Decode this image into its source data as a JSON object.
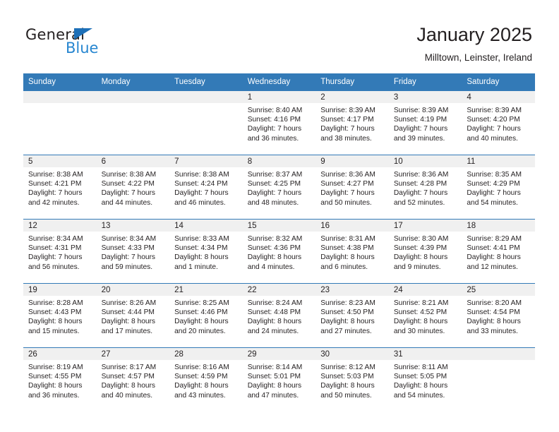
{
  "logo": {
    "word_top": "General",
    "word_bottom": "Blue",
    "triangle_color": "#1d70b8",
    "blue_text_color": "#2786d0"
  },
  "header": {
    "title": "January 2025",
    "subtitle": "Milltown, Leinster, Ireland",
    "accent_color": "#337ab7",
    "daynum_bg": "#f0f0f0"
  },
  "calendar": {
    "weekday_headers": [
      "Sunday",
      "Monday",
      "Tuesday",
      "Wednesday",
      "Thursday",
      "Friday",
      "Saturday"
    ],
    "weeks": [
      [
        {
          "day": "",
          "blank": true
        },
        {
          "day": "",
          "blank": true
        },
        {
          "day": "",
          "blank": true
        },
        {
          "day": "1",
          "sunrise": "Sunrise: 8:40 AM",
          "sunset": "Sunset: 4:16 PM",
          "daylight1": "Daylight: 7 hours",
          "daylight2": "and 36 minutes."
        },
        {
          "day": "2",
          "sunrise": "Sunrise: 8:39 AM",
          "sunset": "Sunset: 4:17 PM",
          "daylight1": "Daylight: 7 hours",
          "daylight2": "and 38 minutes."
        },
        {
          "day": "3",
          "sunrise": "Sunrise: 8:39 AM",
          "sunset": "Sunset: 4:19 PM",
          "daylight1": "Daylight: 7 hours",
          "daylight2": "and 39 minutes."
        },
        {
          "day": "4",
          "sunrise": "Sunrise: 8:39 AM",
          "sunset": "Sunset: 4:20 PM",
          "daylight1": "Daylight: 7 hours",
          "daylight2": "and 40 minutes."
        }
      ],
      [
        {
          "day": "5",
          "sunrise": "Sunrise: 8:38 AM",
          "sunset": "Sunset: 4:21 PM",
          "daylight1": "Daylight: 7 hours",
          "daylight2": "and 42 minutes."
        },
        {
          "day": "6",
          "sunrise": "Sunrise: 8:38 AM",
          "sunset": "Sunset: 4:22 PM",
          "daylight1": "Daylight: 7 hours",
          "daylight2": "and 44 minutes."
        },
        {
          "day": "7",
          "sunrise": "Sunrise: 8:38 AM",
          "sunset": "Sunset: 4:24 PM",
          "daylight1": "Daylight: 7 hours",
          "daylight2": "and 46 minutes."
        },
        {
          "day": "8",
          "sunrise": "Sunrise: 8:37 AM",
          "sunset": "Sunset: 4:25 PM",
          "daylight1": "Daylight: 7 hours",
          "daylight2": "and 48 minutes."
        },
        {
          "day": "9",
          "sunrise": "Sunrise: 8:36 AM",
          "sunset": "Sunset: 4:27 PM",
          "daylight1": "Daylight: 7 hours",
          "daylight2": "and 50 minutes."
        },
        {
          "day": "10",
          "sunrise": "Sunrise: 8:36 AM",
          "sunset": "Sunset: 4:28 PM",
          "daylight1": "Daylight: 7 hours",
          "daylight2": "and 52 minutes."
        },
        {
          "day": "11",
          "sunrise": "Sunrise: 8:35 AM",
          "sunset": "Sunset: 4:29 PM",
          "daylight1": "Daylight: 7 hours",
          "daylight2": "and 54 minutes."
        }
      ],
      [
        {
          "day": "12",
          "sunrise": "Sunrise: 8:34 AM",
          "sunset": "Sunset: 4:31 PM",
          "daylight1": "Daylight: 7 hours",
          "daylight2": "and 56 minutes."
        },
        {
          "day": "13",
          "sunrise": "Sunrise: 8:34 AM",
          "sunset": "Sunset: 4:33 PM",
          "daylight1": "Daylight: 7 hours",
          "daylight2": "and 59 minutes."
        },
        {
          "day": "14",
          "sunrise": "Sunrise: 8:33 AM",
          "sunset": "Sunset: 4:34 PM",
          "daylight1": "Daylight: 8 hours",
          "daylight2": "and 1 minute."
        },
        {
          "day": "15",
          "sunrise": "Sunrise: 8:32 AM",
          "sunset": "Sunset: 4:36 PM",
          "daylight1": "Daylight: 8 hours",
          "daylight2": "and 4 minutes."
        },
        {
          "day": "16",
          "sunrise": "Sunrise: 8:31 AM",
          "sunset": "Sunset: 4:38 PM",
          "daylight1": "Daylight: 8 hours",
          "daylight2": "and 6 minutes."
        },
        {
          "day": "17",
          "sunrise": "Sunrise: 8:30 AM",
          "sunset": "Sunset: 4:39 PM",
          "daylight1": "Daylight: 8 hours",
          "daylight2": "and 9 minutes."
        },
        {
          "day": "18",
          "sunrise": "Sunrise: 8:29 AM",
          "sunset": "Sunset: 4:41 PM",
          "daylight1": "Daylight: 8 hours",
          "daylight2": "and 12 minutes."
        }
      ],
      [
        {
          "day": "19",
          "sunrise": "Sunrise: 8:28 AM",
          "sunset": "Sunset: 4:43 PM",
          "daylight1": "Daylight: 8 hours",
          "daylight2": "and 15 minutes."
        },
        {
          "day": "20",
          "sunrise": "Sunrise: 8:26 AM",
          "sunset": "Sunset: 4:44 PM",
          "daylight1": "Daylight: 8 hours",
          "daylight2": "and 17 minutes."
        },
        {
          "day": "21",
          "sunrise": "Sunrise: 8:25 AM",
          "sunset": "Sunset: 4:46 PM",
          "daylight1": "Daylight: 8 hours",
          "daylight2": "and 20 minutes."
        },
        {
          "day": "22",
          "sunrise": "Sunrise: 8:24 AM",
          "sunset": "Sunset: 4:48 PM",
          "daylight1": "Daylight: 8 hours",
          "daylight2": "and 24 minutes."
        },
        {
          "day": "23",
          "sunrise": "Sunrise: 8:23 AM",
          "sunset": "Sunset: 4:50 PM",
          "daylight1": "Daylight: 8 hours",
          "daylight2": "and 27 minutes."
        },
        {
          "day": "24",
          "sunrise": "Sunrise: 8:21 AM",
          "sunset": "Sunset: 4:52 PM",
          "daylight1": "Daylight: 8 hours",
          "daylight2": "and 30 minutes."
        },
        {
          "day": "25",
          "sunrise": "Sunrise: 8:20 AM",
          "sunset": "Sunset: 4:54 PM",
          "daylight1": "Daylight: 8 hours",
          "daylight2": "and 33 minutes."
        }
      ],
      [
        {
          "day": "26",
          "sunrise": "Sunrise: 8:19 AM",
          "sunset": "Sunset: 4:55 PM",
          "daylight1": "Daylight: 8 hours",
          "daylight2": "and 36 minutes."
        },
        {
          "day": "27",
          "sunrise": "Sunrise: 8:17 AM",
          "sunset": "Sunset: 4:57 PM",
          "daylight1": "Daylight: 8 hours",
          "daylight2": "and 40 minutes."
        },
        {
          "day": "28",
          "sunrise": "Sunrise: 8:16 AM",
          "sunset": "Sunset: 4:59 PM",
          "daylight1": "Daylight: 8 hours",
          "daylight2": "and 43 minutes."
        },
        {
          "day": "29",
          "sunrise": "Sunrise: 8:14 AM",
          "sunset": "Sunset: 5:01 PM",
          "daylight1": "Daylight: 8 hours",
          "daylight2": "and 47 minutes."
        },
        {
          "day": "30",
          "sunrise": "Sunrise: 8:12 AM",
          "sunset": "Sunset: 5:03 PM",
          "daylight1": "Daylight: 8 hours",
          "daylight2": "and 50 minutes."
        },
        {
          "day": "31",
          "sunrise": "Sunrise: 8:11 AM",
          "sunset": "Sunset: 5:05 PM",
          "daylight1": "Daylight: 8 hours",
          "daylight2": "and 54 minutes."
        },
        {
          "day": "",
          "blank": true
        }
      ]
    ]
  }
}
